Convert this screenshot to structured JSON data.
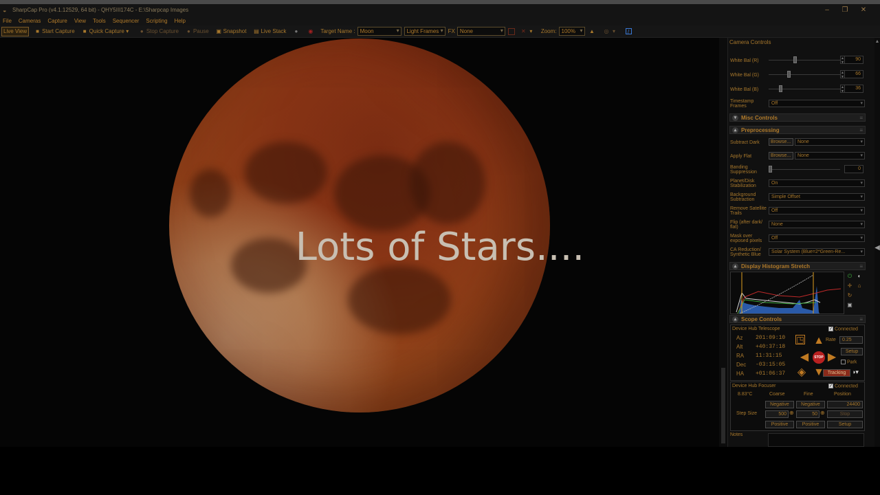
{
  "window": {
    "title": "SharpCap Pro (v4.1.12529, 64 bit) - QHY5III174C - E:\\Sharpcap Images",
    "min_glyph": "–",
    "max_glyph": "❐",
    "close_glyph": "✕"
  },
  "menu": [
    "File",
    "Cameras",
    "Capture",
    "View",
    "Tools",
    "Sequencer",
    "Scripting",
    "Help"
  ],
  "toolbar": {
    "live_view": "Live View",
    "start_capture": "Start Capture",
    "quick_capture": "Quick Capture",
    "stop_capture": "Stop Capture",
    "pause": "Pause",
    "snapshot": "Snapshot",
    "live_stack": "Live Stack",
    "target_name_label": "Target Name :",
    "target_name_value": "Moon",
    "frame_type": "Light Frames",
    "fx_label": "FX",
    "fx_value": "None",
    "zoom_label": "Zoom:",
    "zoom_value": "100%"
  },
  "viewport": {
    "overlay_text": "Lots of Stars...."
  },
  "camera_controls": {
    "header": "Camera Controls",
    "white_bal_r_label": "White Bal (R)",
    "white_bal_r": "90",
    "white_bal_r_level": 0.35,
    "white_bal_g_label": "White Bal (G)",
    "white_bal_g": "66",
    "white_bal_g_level": 0.26,
    "white_bal_b_label": "White Bal (B)",
    "white_bal_b": "36",
    "white_bal_b_level": 0.14,
    "timestamp_label": "Timestamp Frames",
    "timestamp_value": "Off"
  },
  "misc_controls": {
    "header": "Misc Controls"
  },
  "preprocessing": {
    "header": "Preprocessing",
    "subtract_dark_label": "Subtract Dark",
    "subtract_dark_browse": "Browse...",
    "subtract_dark_value": "None",
    "apply_flat_label": "Apply Flat",
    "apply_flat_browse": "Browse...",
    "apply_flat_value": "None",
    "banding_label": "Banding Suppression",
    "banding_value": "0",
    "stabilization_label": "Planet/Disk Stabilization",
    "stabilization_value": "On",
    "bg_sub_label": "Background Subtraction",
    "bg_sub_value": "Simple Offset",
    "sat_trails_label": "Remove Satellite Trails",
    "sat_trails_value": "Off",
    "flip_label": "Flip (after dark/ flat)",
    "flip_value": "None",
    "mask_label": "Mask over exposed pixels",
    "mask_value": "Off",
    "ca_label": "CA Reduction/ Synthetic Blue",
    "ca_value": "Solar System (Blue=2*Green-Re..."
  },
  "histogram": {
    "header": "Display Histogram Stretch"
  },
  "scope_controls": {
    "header": "Scope Controls",
    "telescope_label": "Device Hub Telescope",
    "connected_label": "Connected",
    "coords": [
      {
        "k": "Az",
        "v": "201:09:10"
      },
      {
        "k": "Alt",
        "v": "+40:37:18"
      },
      {
        "k": "RA",
        "v": "11:31:15"
      },
      {
        "k": "Dec",
        "v": "-03:15:05"
      },
      {
        "k": "HA",
        "v": "+01:06:37"
      }
    ],
    "rate_label": "Rate",
    "rate_value": "0.25",
    "setup": "Setup",
    "park": "Park",
    "tracking": "Tracking",
    "stop": "STOP",
    "focuser_label": "Device Hub Focuser",
    "focuser_connected": "Connected",
    "temp": "8.83°C",
    "coarse": "Coarse",
    "fine": "Fine",
    "position": "Position",
    "negative_coarse": "Negative",
    "negative_fine": "Negative",
    "position_value": "24400",
    "step_size_label": "Step Size",
    "step_coarse": "500",
    "step_fine": "50",
    "stop_btn": "Stop",
    "positive_coarse": "Positive",
    "positive_fine": "Positive",
    "focus_setup": "Setup"
  },
  "notes": {
    "label": "Notes"
  },
  "colors": {
    "accent": "#b07a2a",
    "stop_red": "#b82020",
    "histogram_blue": "#2a5aa8",
    "histogram_red": "#c02a2a"
  }
}
